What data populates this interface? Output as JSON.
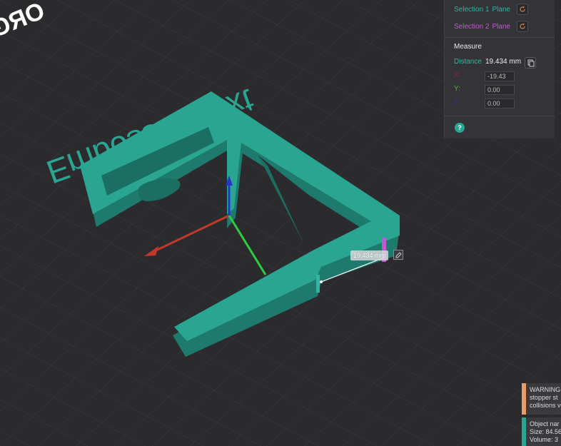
{
  "viewport": {
    "embossed_text": "Embossed text",
    "brand_text": "ORG",
    "measure_label": "19.434 mm"
  },
  "measure_panel": {
    "selection1": {
      "label": "Selection 1",
      "type": "Plane",
      "color": "#2fb5a3"
    },
    "selection2": {
      "label": "Selection 2",
      "type": "Plane",
      "color": "#c05ad0"
    },
    "title": "Measure",
    "distance_label": "Distance",
    "distance_value": "19.434 mm",
    "x_label": "X:",
    "x_value": "-19.43",
    "y_label": "Y:",
    "y_value": "0.00",
    "z_label": "Z:",
    "z_value": "0.00",
    "help": "?"
  },
  "notifications": {
    "warning": {
      "lines": [
        "WARNING",
        "stopper st",
        "collisions v"
      ],
      "color": "#e89d66"
    },
    "object_info": {
      "lines": [
        "Object nar",
        "Size: 84.56",
        "Volume: 3"
      ],
      "color": "#2aa592"
    }
  },
  "colors": {
    "model": "#2aa592",
    "x_axis": "#c0392b",
    "y_axis": "#2ecc40",
    "z_axis": "#2535c8"
  }
}
